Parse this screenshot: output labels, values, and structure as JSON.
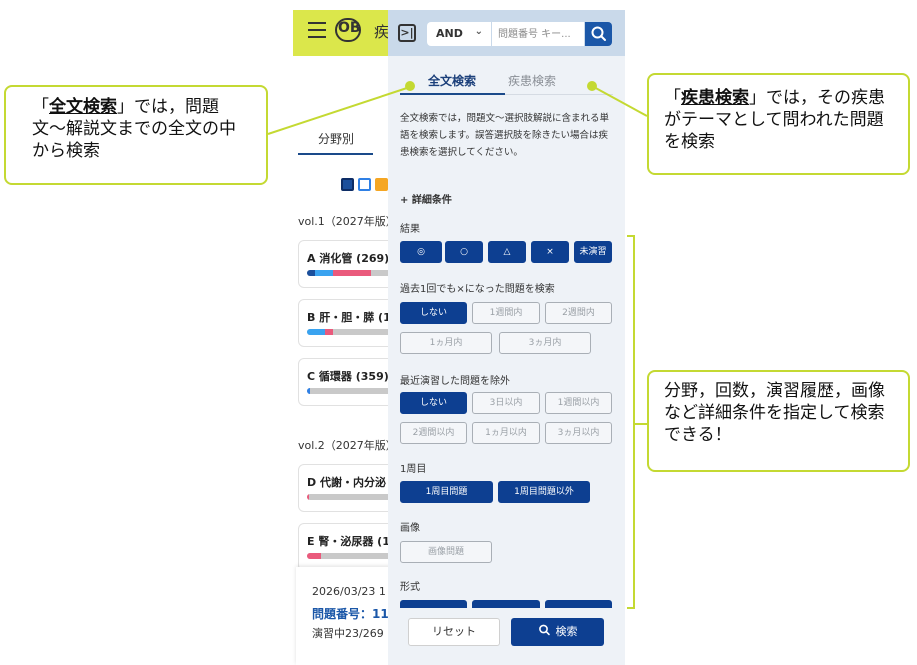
{
  "app": {
    "logo_text": "OB",
    "title_fragment": "疾"
  },
  "background": {
    "tab_label": "分野別",
    "squares": [
      "#1b4f9c",
      "#2f80e5",
      "#f5a623"
    ],
    "vol1_label": "vol.1（2027年版）",
    "vol2_label": "vol.2（2027年版）",
    "cards": [
      {
        "title": "A 消化管 (269)",
        "segments": [
          {
            "c": "#1b4f9c",
            "w": 8
          },
          {
            "c": "#3aa3f0",
            "w": 18
          },
          {
            "c": "#ea5a7c",
            "w": 38
          }
        ]
      },
      {
        "title": "B 肝・胆・膵 (1",
        "segments": [
          {
            "c": "#3aa3f0",
            "w": 18
          },
          {
            "c": "#ea5a7c",
            "w": 8
          }
        ]
      },
      {
        "title": "C 循環器 (359)",
        "segments": [
          {
            "c": "#2f80e5",
            "w": 3
          }
        ]
      },
      {
        "title": "D 代謝・内分泌",
        "segments": [
          {
            "c": "#ea5a7c",
            "w": 2
          }
        ]
      },
      {
        "title": "E 腎・泌尿器 (1",
        "segments": [
          {
            "c": "#ea5a7c",
            "w": 14
          }
        ]
      }
    ],
    "history": {
      "date": "2026/03/23 1",
      "number": "問題番号：11",
      "progress": "演習中23/269"
    }
  },
  "panel": {
    "operator": "AND",
    "search_placeholder": "問題番号 キー...",
    "tabs": {
      "full": "全文検索",
      "disease": "疾患検索"
    },
    "description": "全文検索では，問題文〜選択肢解説に含まれる単語を検索します。誤答選択肢を除きたい場合は疾患検索を選択してください。",
    "advanced_label": "+ 詳細条件",
    "result": {
      "label": "結果",
      "options": [
        "◎",
        "○",
        "△",
        "×",
        "未演習"
      ]
    },
    "wrong": {
      "label": "過去1回でも×になった問題を検索",
      "options": [
        "しない",
        "1週間内",
        "2週間内",
        "1ヵ月内",
        "3ヵ月内"
      ]
    },
    "recent": {
      "label": "最近演習した問題を除外",
      "options": [
        "しない",
        "3日以内",
        "1週間以内",
        "2週間以内",
        "1ヵ月以内",
        "3ヵ月以内"
      ]
    },
    "first": {
      "label": "1周目",
      "options": [
        "1周目問題",
        "1周目問題以外"
      ]
    },
    "image": {
      "label": "画像",
      "options": [
        "画像問題"
      ]
    },
    "format": {
      "label": "形式"
    },
    "reset_label": "リセット",
    "submit_label": "検索"
  },
  "callouts": {
    "left": {
      "keyword": "全文検索",
      "pre": "「",
      "post": "」では，問題文〜解説文までの全文の中から検索"
    },
    "right": {
      "keyword": "疾患検索",
      "pre": "「",
      "post": "」では，その疾患がテーマとして問われた問題を検索"
    },
    "bottom": {
      "text": "分野，回数，演習履歴，画像など詳細条件を指定して検索できる！"
    }
  },
  "colors": {
    "accent": "#0d3f91",
    "header_yellow": "#dbe74b",
    "callout_border": "#c4d932"
  }
}
